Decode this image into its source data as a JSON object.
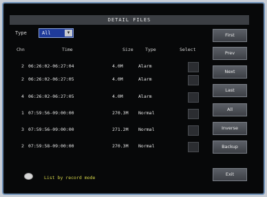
{
  "dialog": {
    "title": "DETAIL FILES"
  },
  "filter": {
    "label": "Type",
    "value": "All",
    "arrow": "▼"
  },
  "columns": {
    "ch": "Chn",
    "time": "Time",
    "size": "Size",
    "type": "Type",
    "select": "Select"
  },
  "rows": [
    {
      "ch": "2",
      "time": "06:26:02-06:27:04",
      "size": "4.0M",
      "type": "Alarm"
    },
    {
      "ch": "2",
      "time": "06:26:02-06:27:05",
      "size": "4.0M",
      "type": "Alarm"
    },
    {
      "ch": "4",
      "time": "06:26:02-06:27:05",
      "size": "4.0M",
      "type": "Alarm"
    },
    {
      "ch": "1",
      "time": "07:59:56-09:00:00",
      "size": "270.3M",
      "type": "Normal"
    },
    {
      "ch": "3",
      "time": "07:59:56-09:00:00",
      "size": "271.2M",
      "type": "Normal"
    },
    {
      "ch": "2",
      "time": "07:59:58-09:00:00",
      "size": "270.3M",
      "type": "Normal"
    }
  ],
  "buttons": {
    "first": "First",
    "prev": "Prev",
    "next": "Next",
    "last": "Last",
    "all": "All",
    "inverse": "Inverse",
    "backup": "Backup",
    "exit": "Exit"
  },
  "hint": {
    "text": "List by record mode",
    "icon": "eye-icon"
  }
}
